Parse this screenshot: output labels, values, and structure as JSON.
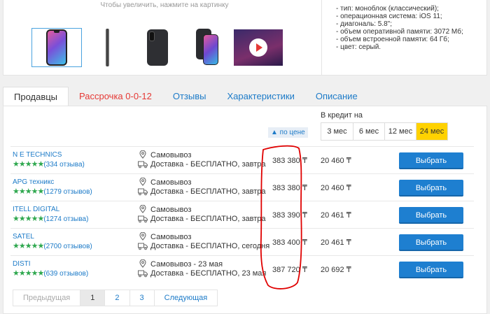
{
  "gallery": {
    "hint": "Чтобы увеличить, нажмите на картинку"
  },
  "specs": [
    "- тип: моноблок (классический);",
    "- операционная система: iOS 11;",
    "- диагональ: 5.8\";",
    "- объем оперативной памяти: 3072 Мб;",
    "- объем встроенной памяти: 64 Гб;",
    "- цвет: серый."
  ],
  "tabs": [
    "Продавцы",
    "Рассрочка 0-0-12",
    "Отзывы",
    "Характеристики",
    "Описание"
  ],
  "credit": {
    "label": "В кредит на",
    "months": [
      "3 мес",
      "6 мес",
      "12 мес",
      "24 мес"
    ],
    "active_index": 3
  },
  "sort_label": "▲ по цене",
  "sellers": [
    {
      "name": "N E TECHNICS",
      "stars": "★★★★★",
      "reviews": "(334 отзыва)",
      "pickup": "Самовывоз",
      "delivery": "Доставка - БЕСПЛАТНО, завтра",
      "price": "383 380 ₸",
      "credit": "20 460 ₸",
      "button": "Выбрать"
    },
    {
      "name": "APG техникс",
      "stars": "★★★★★",
      "reviews": "(1279 отзывов)",
      "pickup": "Самовывоз",
      "delivery": "Доставка - БЕСПЛАТНО, завтра",
      "price": "383 380 ₸",
      "credit": "20 460 ₸",
      "button": "Выбрать"
    },
    {
      "name": "ITELL DIGITAL",
      "stars": "★★★★★",
      "reviews": "(1274 отзыва)",
      "pickup": "Самовывоз",
      "delivery": "Доставка - БЕСПЛАТНО, завтра",
      "price": "383 390 ₸",
      "credit": "20 461 ₸",
      "button": "Выбрать"
    },
    {
      "name": "SATEL",
      "stars": "★★★★★",
      "reviews": "(2700 отзывов)",
      "pickup": "Самовывоз",
      "delivery": "Доставка - БЕСПЛАТНО, сегодня",
      "price": "383 400 ₸",
      "credit": "20 461 ₸",
      "button": "Выбрать"
    },
    {
      "name": "DISTI",
      "stars": "★★★★★",
      "reviews": "(639 отзывов)",
      "pickup": "Самовывоз - 23 мая",
      "delivery": "Доставка - БЕСПЛАТНО, 23 мая",
      "price": "387 720 ₸",
      "credit": "20 692 ₸",
      "button": "Выбрать"
    }
  ],
  "pager": {
    "prev": "Предыдущая",
    "pages": [
      "1",
      "2",
      "3"
    ],
    "current": "1",
    "next": "Следующая"
  },
  "colors": {
    "link": "#1d7bc8",
    "button": "#1e7fd0",
    "accent_yellow": "#ffd200",
    "stars": "#2fa84f",
    "annotation": "#e00000"
  }
}
